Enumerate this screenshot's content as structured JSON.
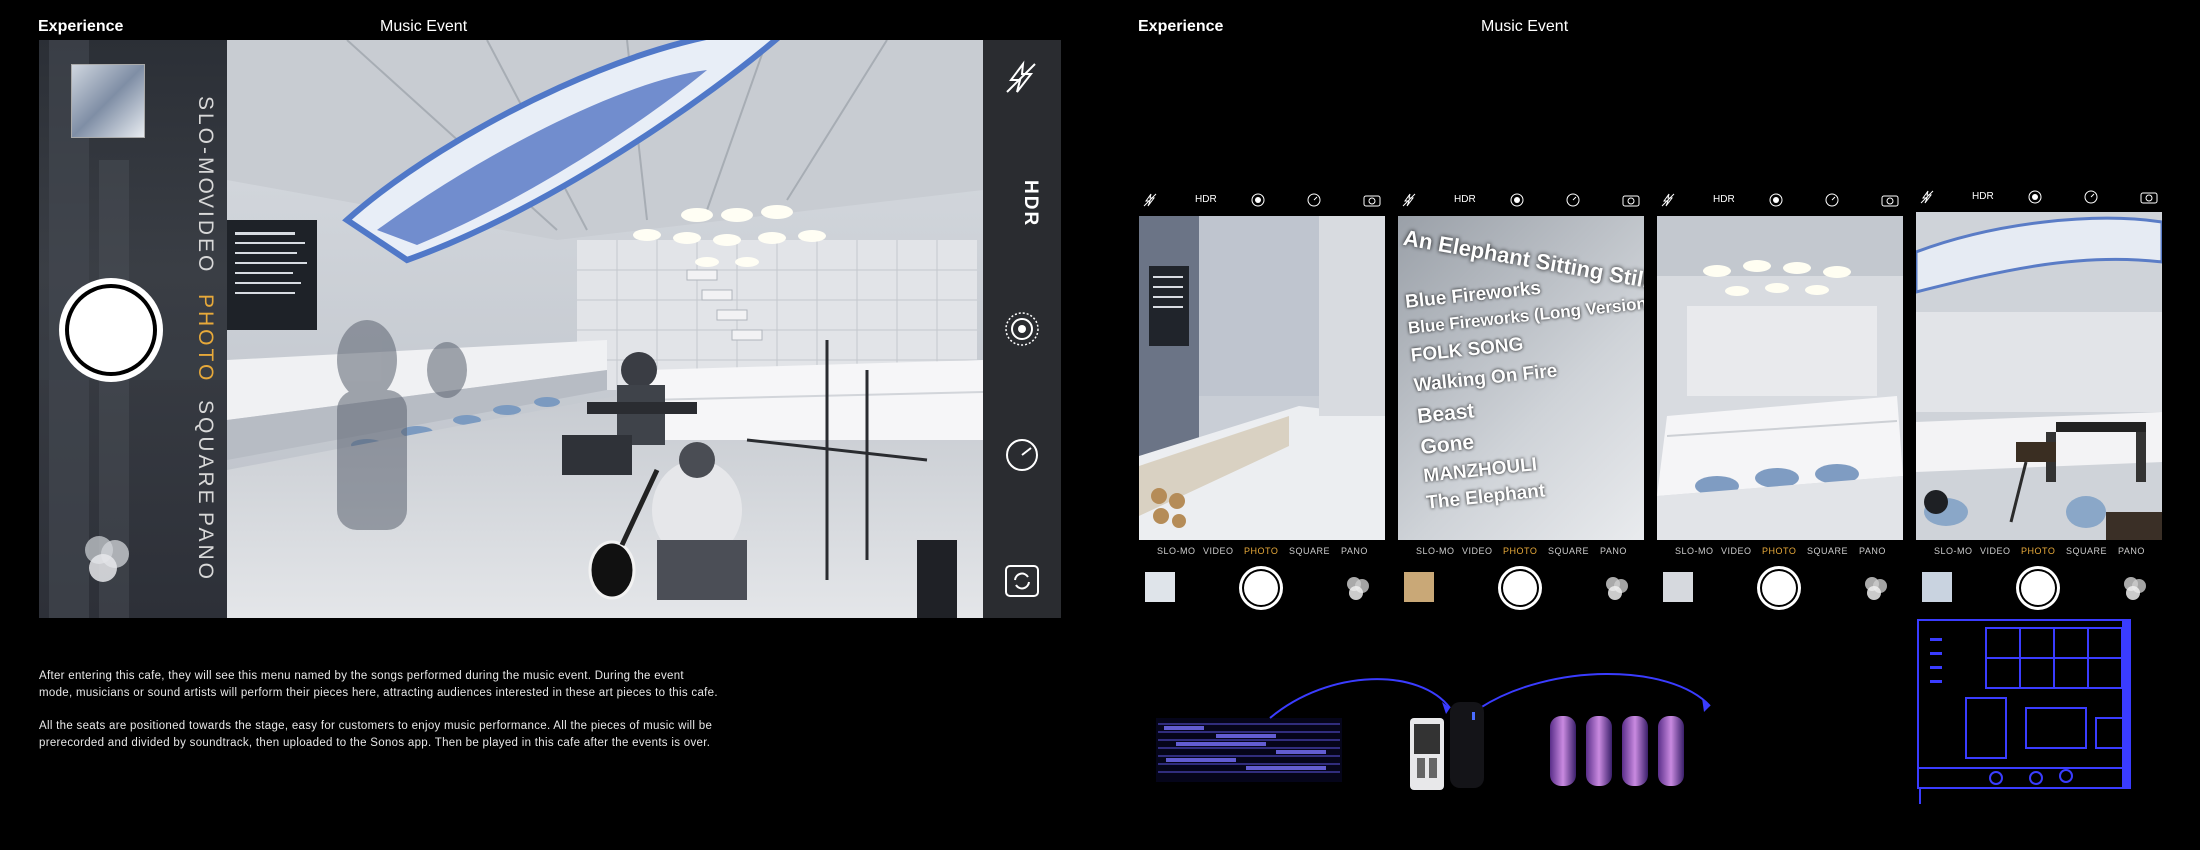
{
  "left_header": {
    "experience": "Experience",
    "event": "Music Event"
  },
  "right_header": {
    "experience": "Experience",
    "event": "Music Event"
  },
  "big_camera": {
    "modes": [
      "SLO-MO",
      "VIDEO",
      "PHOTO",
      "SQUARE",
      "PANO"
    ],
    "active_mode": "PHOTO",
    "hdr_label": "HDR",
    "flash_state": "off",
    "accent_color": "#e7a93a"
  },
  "phones": [
    {
      "top": {
        "hdr": "HDR"
      },
      "modes": [
        "SLO-MO",
        "VIDEO",
        "PHOTO",
        "SQUARE",
        "PANO"
      ],
      "active_mode": "PHOTO",
      "menu_lines": []
    },
    {
      "top": {
        "hdr": "HDR"
      },
      "modes": [
        "SLO-MO",
        "VIDEO",
        "PHOTO",
        "SQUARE",
        "PANO"
      ],
      "active_mode": "PHOTO",
      "menu_lines": [
        "An Elephant Sitting Still - The",
        "Blue Fireworks",
        "Blue Fireworks (Long Version)",
        "FOLK SONG",
        "Walking On Fire",
        "Beast",
        "Gone",
        "MANZHOULI",
        "The Elephant"
      ]
    },
    {
      "top": {
        "hdr": "HDR"
      },
      "modes": [
        "SLO-MO",
        "VIDEO",
        "PHOTO",
        "SQUARE",
        "PANO"
      ],
      "active_mode": "PHOTO",
      "menu_lines": []
    },
    {
      "top": {
        "hdr": "HDR"
      },
      "modes": [
        "SLO-MO",
        "VIDEO",
        "PHOTO",
        "SQUARE",
        "PANO"
      ],
      "active_mode": "PHOTO",
      "menu_lines": []
    }
  ],
  "captions": [
    "After entering this cafe, they will see this menu named by the songs performed during the music event. During the event mode, musicians or sound artists will perform their pieces here, attracting audiences interested in these art pieces to this cafe.",
    "All the seats are positioned towards the stage, easy for customers to enjoy music performance. All the pieces of music will be prerecorded and divided by soundtrack, then uploaded to the Sonos app. Then be played in this cafe after the events is over."
  ],
  "colors": {
    "blueprint": "#3a3cff",
    "speaker_pink": "#b06ad0",
    "background": "#000000"
  }
}
